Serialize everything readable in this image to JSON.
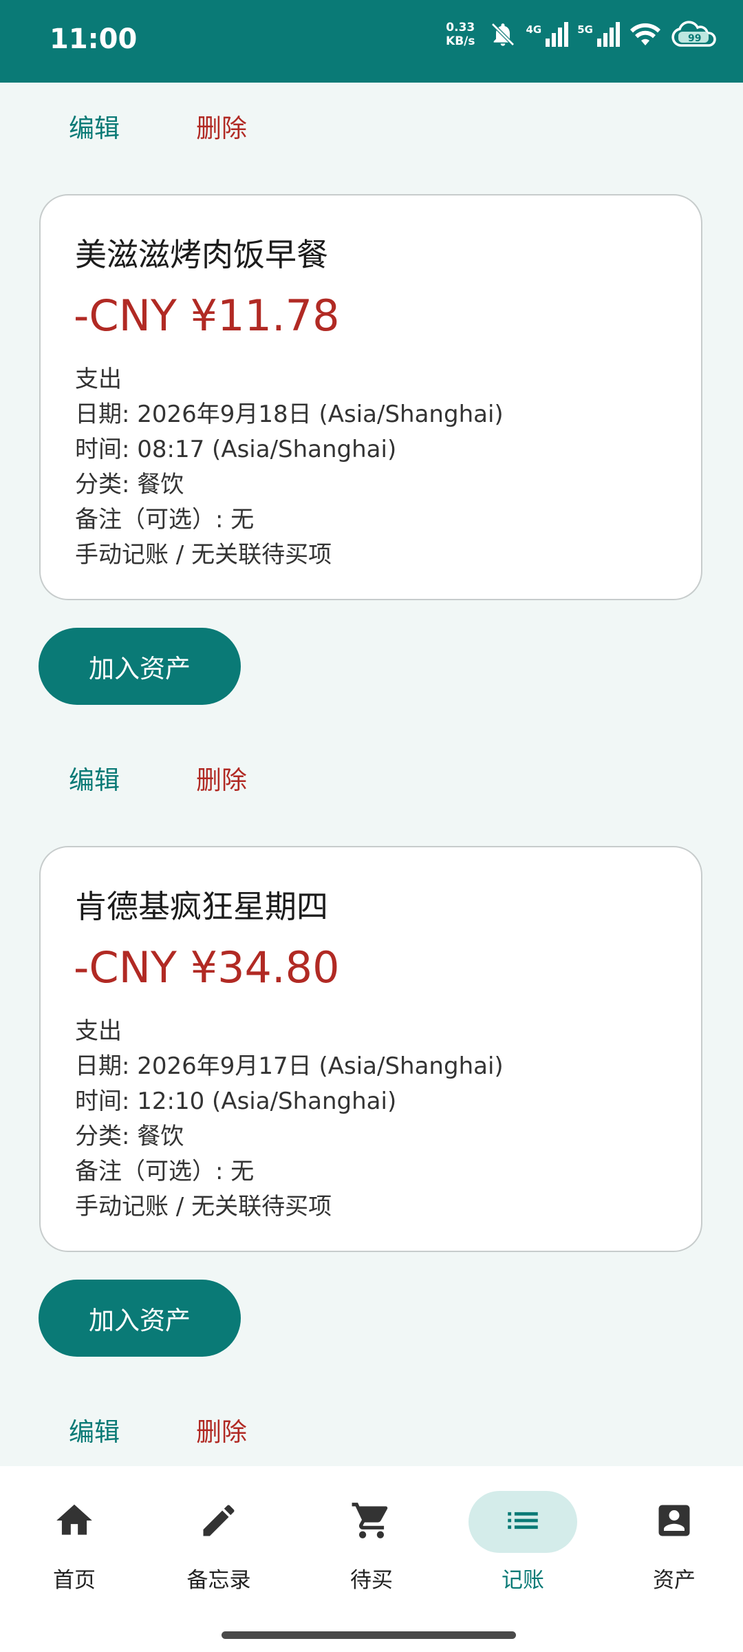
{
  "status_bar": {
    "time": "11:00",
    "speed_value": "0.33",
    "speed_unit": "KB/s",
    "net1": "4G",
    "net2": "5G",
    "battery": "99"
  },
  "entries": [
    {
      "top_actions": {
        "edit_label": "编辑",
        "delete_label": "删除"
      },
      "title": "美滋滋烤肉饭早餐",
      "amount": "-CNY ¥11.78",
      "type": "支出",
      "date": "日期: 2026年9月18日 (Asia/Shanghai)",
      "time": "时间: 08:17 (Asia/Shanghai)",
      "category": "分类: 餐饮",
      "note": "备注（可选）: 无",
      "source": "手动记账 / 无关联待买项",
      "button_label": "加入资产"
    },
    {
      "top_actions": {
        "edit_label": "编辑",
        "delete_label": "删除"
      },
      "title": "肯德基疯狂星期四",
      "amount": "-CNY ¥34.80",
      "type": "支出",
      "date": "日期: 2026年9月17日 (Asia/Shanghai)",
      "time": "时间: 12:10 (Asia/Shanghai)",
      "category": "分类: 餐饮",
      "note": "备注（可选）: 无",
      "source": "手动记账 / 无关联待买项",
      "button_label": "加入资产"
    }
  ],
  "bottom_actions": {
    "edit_label": "编辑",
    "delete_label": "删除"
  },
  "nav": [
    {
      "label": "首页",
      "icon": "home-icon"
    },
    {
      "label": "备忘录",
      "icon": "pencil-icon"
    },
    {
      "label": "待买",
      "icon": "cart-icon"
    },
    {
      "label": "记账",
      "icon": "list-icon",
      "active": true
    },
    {
      "label": "资产",
      "icon": "account-box-icon"
    }
  ],
  "colors": {
    "primary": "#0a7a76",
    "expense": "#b12a24",
    "background": "#f1f7f6",
    "nav_active_bg": "#d4ecea"
  }
}
